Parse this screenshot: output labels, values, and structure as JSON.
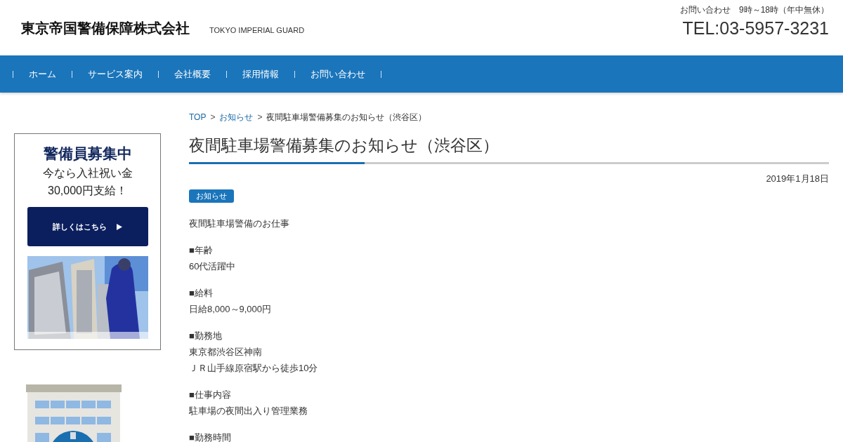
{
  "header": {
    "logo": "東京帝国警備保障株式会社",
    "tagline": "TOKYO IMPERIAL GUARD",
    "contact_hours": "お問い合わせ　9時～18時（年中無休）",
    "phone": "TEL:03-5957-3231"
  },
  "nav": {
    "items": [
      {
        "label": "ホーム"
      },
      {
        "label": "サービス案内"
      },
      {
        "label": "会社概要"
      },
      {
        "label": "採用情報"
      },
      {
        "label": "お問い合わせ"
      }
    ]
  },
  "sidebar": {
    "banner": {
      "heading": "警備員募集中",
      "line_1": "今なら入社祝い金",
      "line_2": "30,000円支給！",
      "button": "詳しくはこちら"
    }
  },
  "breadcrumb": [
    {
      "kind": "link",
      "label": "TOP"
    },
    {
      "kind": "separator",
      "label": ">"
    },
    {
      "kind": "link",
      "label": "お知らせ"
    },
    {
      "kind": "separator",
      "label": ">"
    },
    {
      "kind": "current",
      "label": "夜間駐車場警備募集のお知らせ（渋谷区）"
    }
  ],
  "article": {
    "title": "夜間駐車場警備募集のお知らせ（渋谷区）",
    "date": "2019年1月18日",
    "category": "お知らせ",
    "paragraphs": [
      {
        "lines": [
          "夜間駐車場警備のお仕事"
        ]
      },
      {
        "lines": [
          "■年齢",
          "60代活躍中"
        ]
      },
      {
        "lines": [
          "■給料",
          "日給8,000～9,000円"
        ]
      },
      {
        "lines": [
          "■勤務地",
          "東京都渋谷区神南",
          "ＪＲ山手線原宿駅から徒歩10分"
        ]
      },
      {
        "lines": [
          "■仕事内容",
          "駐車場の夜間出入り管理業務"
        ]
      },
      {
        "lines": [
          "■勤務時間"
        ]
      }
    ]
  }
}
